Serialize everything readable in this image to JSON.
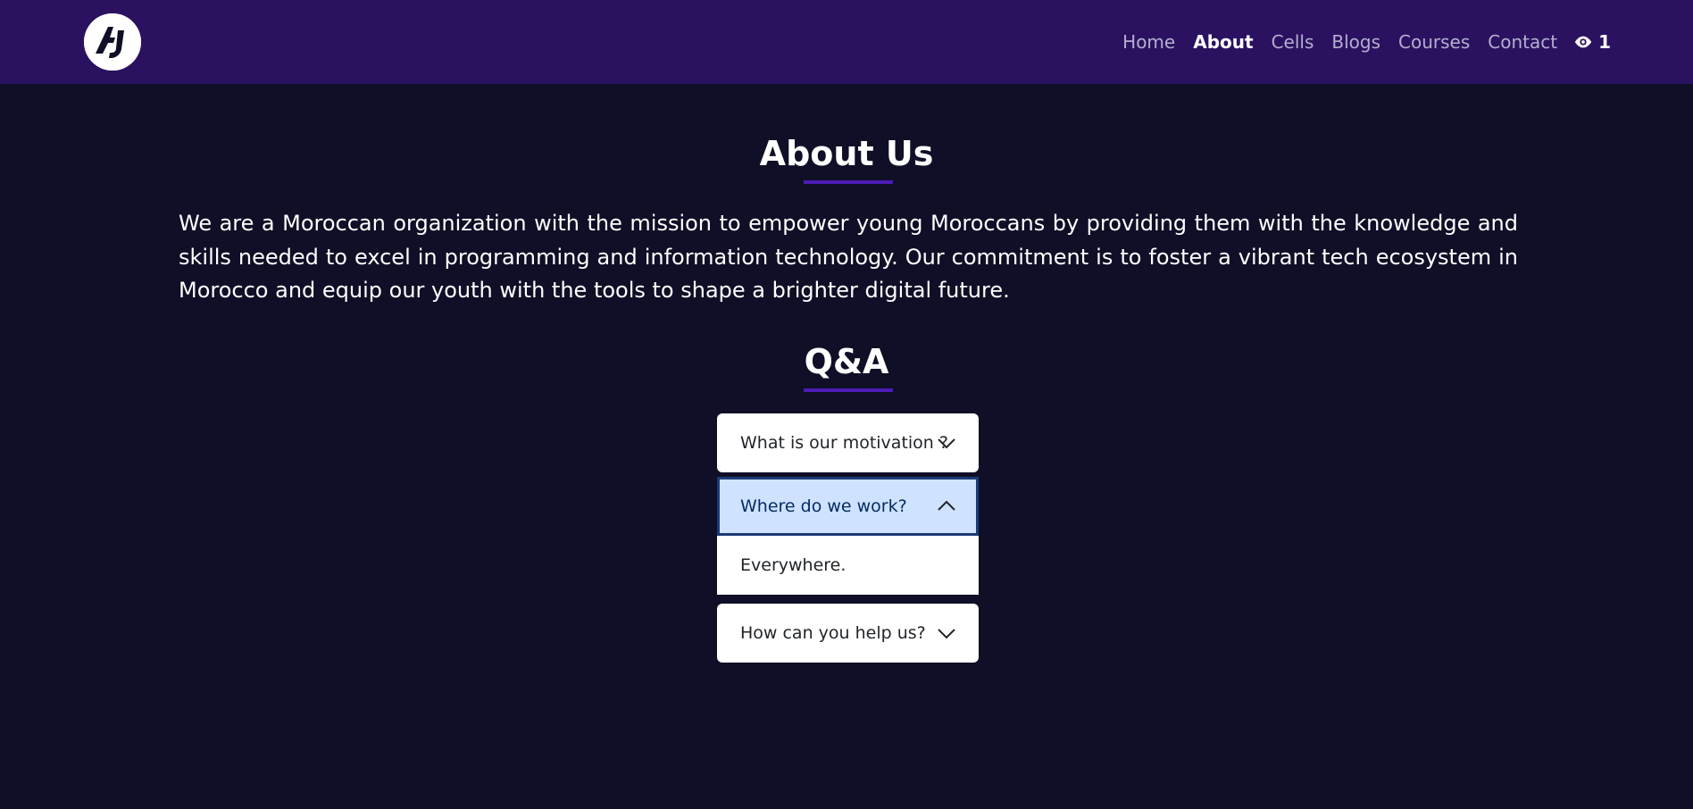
{
  "navbar": {
    "logo_icon": "aj-logo",
    "links": [
      {
        "label": "Home"
      },
      {
        "label": "About"
      },
      {
        "label": "Cells"
      },
      {
        "label": "Blogs"
      },
      {
        "label": "Courses"
      },
      {
        "label": "Contact"
      }
    ],
    "active_link": "About",
    "views_icon": "eye-icon",
    "views_count": "1"
  },
  "about": {
    "title": "About Us",
    "text": "We are a Moroccan organization with the mission to empower young Moroccans by providing them with the knowledge and skills needed to excel in programming and information technology. Our commitment is to foster a vibrant tech ecosystem in Morocco and equip our youth with the tools to shape a brighter digital future."
  },
  "qa": {
    "title": "Q&A",
    "items": [
      {
        "question": "What is our motivation ?",
        "expanded": false
      },
      {
        "question": "Where do we work?",
        "expanded": true,
        "answer": "Everywhere."
      },
      {
        "question": "How can you help us?",
        "expanded": false
      }
    ]
  },
  "colors": {
    "navbar_bg": "#2b1260",
    "page_bg": "#0f0f27",
    "accent_underline": "#4d1bb6",
    "accordion_open_bg": "#cfe2ff"
  }
}
